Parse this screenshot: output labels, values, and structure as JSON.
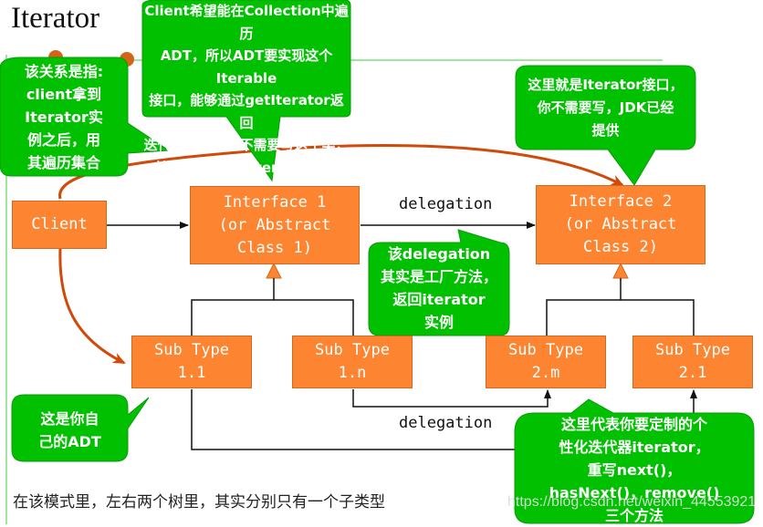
{
  "title": "Iterator",
  "colors": {
    "box_fill": "#fd8430",
    "callout_fill": "#00c000",
    "arrow_red": "#d04a0a",
    "accent_line": "#7ee07e"
  },
  "boxes": {
    "client": "Client",
    "interface1": "Interface 1\n(or Abstract\nClass 1)",
    "interface2": "Interface 2\n(or Abstract\nClass 2)",
    "sub11": "Sub Type\n1.1",
    "sub1n": "Sub Type\n1.n",
    "sub2m": "Sub Type\n2.m",
    "sub21": "Sub Type\n2.1"
  },
  "edge_labels": {
    "delegation_top": "delegation",
    "delegation_bottom": "delegation"
  },
  "callouts": {
    "relation": "该关系是指:\nclient拿到\nIterator实\n例之后，用\n其遍历集合",
    "iterable": "Client希望能在Collection中遍历\nADT，所以ADT要实现这个Iterable\n接口，能够通过getIterator返回\n迭代器实例。你不需要写这个类，\n就是JDK提供的Iterable接口",
    "iterator_iface": "这里就是Iterator接口，\n你不需要写，JDK已经\n提供",
    "factory": "该delegation\n其实是工厂方法，\n返回iterator\n实例",
    "own_adt": "这是你自\n己的ADT",
    "custom_iterator": "这里代表你要定制的个\n性化迭代器iterator，\n重写next()，\nhasNext()，remove()\n三个方法"
  },
  "footnote": "在该模式里，左右两个树里，其实分别只有一个子类型",
  "watermark": "https://blog.csdn.net/weixin_44553921"
}
